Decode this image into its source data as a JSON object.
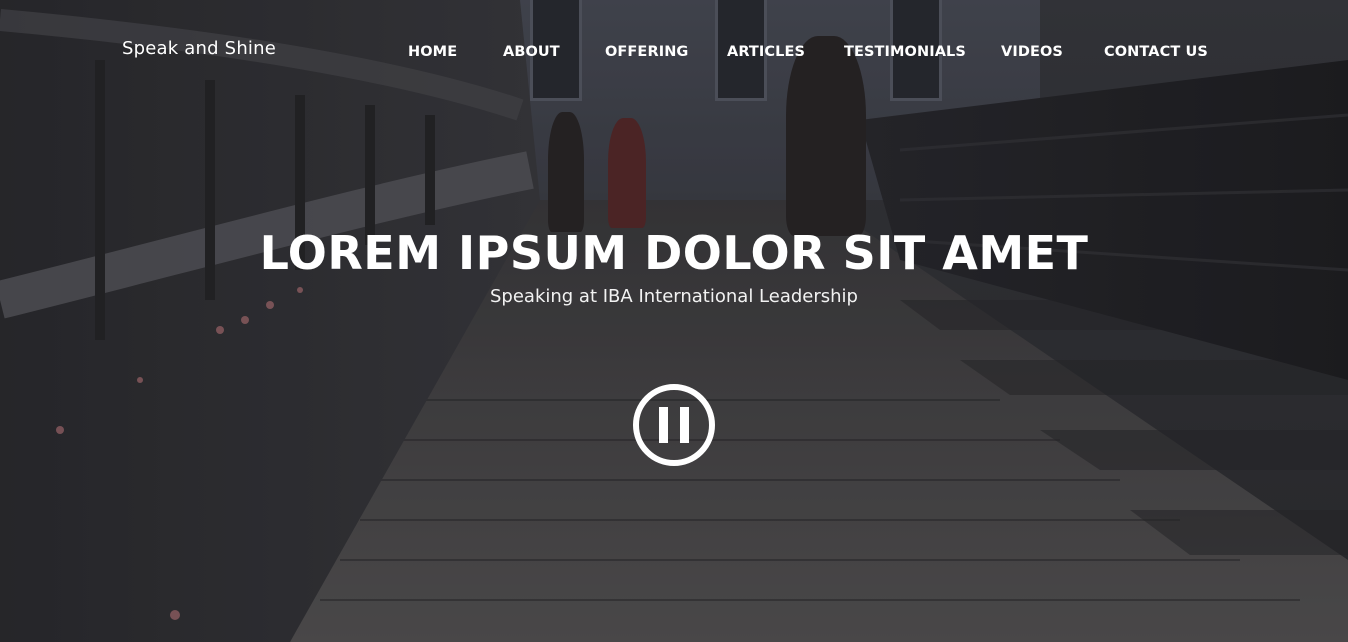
{
  "brand": {
    "name": "Speak and Shine"
  },
  "nav": {
    "items": [
      {
        "label": "HOME"
      },
      {
        "label": "ABOUT"
      },
      {
        "label": "OFFERING"
      },
      {
        "label": "ARTICLES"
      },
      {
        "label": "TESTIMONIALS"
      },
      {
        "label": "VIDEOS"
      },
      {
        "label": "CONTACT US"
      }
    ]
  },
  "hero": {
    "title": "LOREM IPSUM DOLOR SIT AMET",
    "subtitle": "Speaking at IBA International Leadership",
    "control_icon": "pause-circle-icon"
  },
  "colors": {
    "text": "#ffffff",
    "background": "#2b2b2e"
  }
}
